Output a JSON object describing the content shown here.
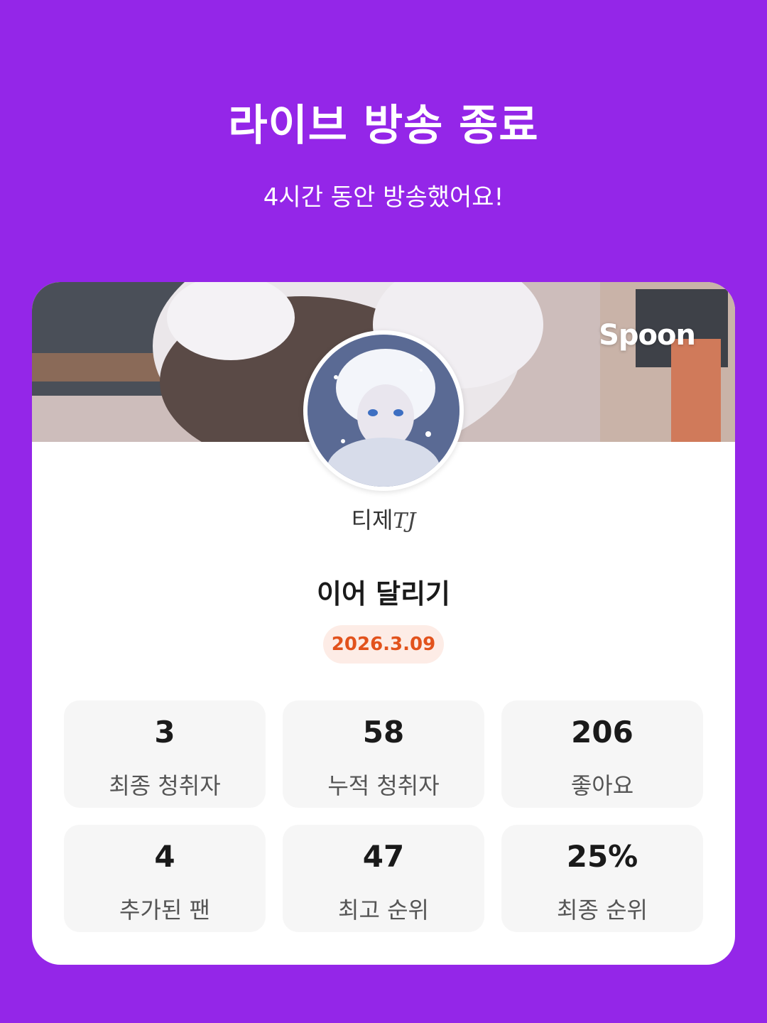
{
  "header": {
    "title": "라이브 방송 종료",
    "subtitle": "4시간 동안 방송했어요!"
  },
  "card": {
    "brand": "Spoon",
    "dj_name": "티제",
    "dj_name_script": "TJ",
    "show_title": "이어 달리기",
    "date": "2026.3.09",
    "stats": [
      {
        "value": "3",
        "label": "최종 청취자"
      },
      {
        "value": "58",
        "label": "누적 청취자"
      },
      {
        "value": "206",
        "label": "좋아요"
      },
      {
        "value": "4",
        "label": "추가된 팬"
      },
      {
        "value": "47",
        "label": "최고 순위"
      },
      {
        "value": "25%",
        "label": "최종 순위"
      }
    ]
  },
  "colors": {
    "background": "#9426E8",
    "date_badge_bg": "#FDECE6",
    "date_badge_text": "#E2521C"
  }
}
